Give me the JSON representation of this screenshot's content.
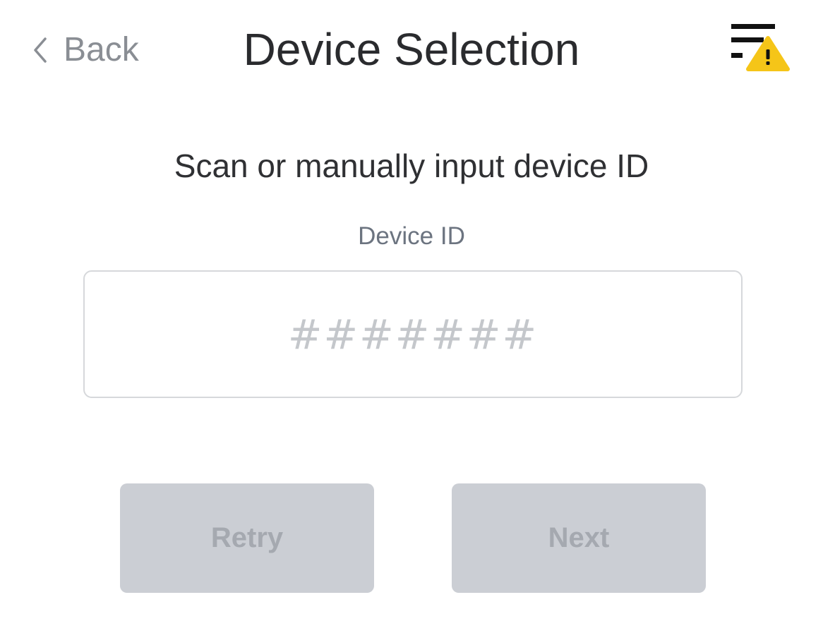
{
  "header": {
    "back_label": "Back",
    "title": "Device Selection",
    "icons": {
      "back": "chevron-left-icon",
      "status": "filter-warning-icon"
    },
    "warning_color": "#f5c518"
  },
  "main": {
    "instruction": "Scan or manually input device ID",
    "device_id": {
      "label": "Device ID",
      "placeholder": "#######",
      "value": ""
    },
    "buttons": {
      "retry_label": "Retry",
      "next_label": "Next",
      "disabled_color": "#cbced4"
    }
  }
}
